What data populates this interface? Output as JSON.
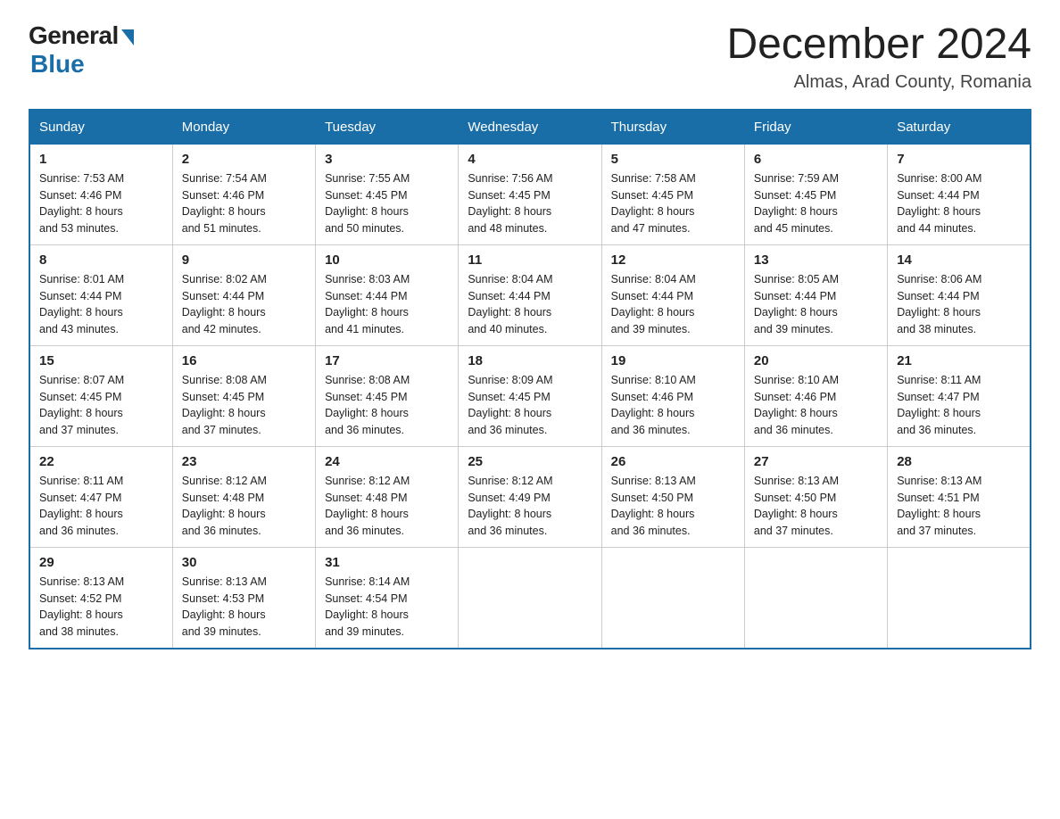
{
  "logo": {
    "general": "General",
    "blue": "Blue"
  },
  "title": "December 2024",
  "location": "Almas, Arad County, Romania",
  "days_of_week": [
    "Sunday",
    "Monday",
    "Tuesday",
    "Wednesday",
    "Thursday",
    "Friday",
    "Saturday"
  ],
  "weeks": [
    [
      {
        "day": "1",
        "sunrise": "7:53 AM",
        "sunset": "4:46 PM",
        "daylight": "8 hours and 53 minutes."
      },
      {
        "day": "2",
        "sunrise": "7:54 AM",
        "sunset": "4:46 PM",
        "daylight": "8 hours and 51 minutes."
      },
      {
        "day": "3",
        "sunrise": "7:55 AM",
        "sunset": "4:45 PM",
        "daylight": "8 hours and 50 minutes."
      },
      {
        "day": "4",
        "sunrise": "7:56 AM",
        "sunset": "4:45 PM",
        "daylight": "8 hours and 48 minutes."
      },
      {
        "day": "5",
        "sunrise": "7:58 AM",
        "sunset": "4:45 PM",
        "daylight": "8 hours and 47 minutes."
      },
      {
        "day": "6",
        "sunrise": "7:59 AM",
        "sunset": "4:45 PM",
        "daylight": "8 hours and 45 minutes."
      },
      {
        "day": "7",
        "sunrise": "8:00 AM",
        "sunset": "4:44 PM",
        "daylight": "8 hours and 44 minutes."
      }
    ],
    [
      {
        "day": "8",
        "sunrise": "8:01 AM",
        "sunset": "4:44 PM",
        "daylight": "8 hours and 43 minutes."
      },
      {
        "day": "9",
        "sunrise": "8:02 AM",
        "sunset": "4:44 PM",
        "daylight": "8 hours and 42 minutes."
      },
      {
        "day": "10",
        "sunrise": "8:03 AM",
        "sunset": "4:44 PM",
        "daylight": "8 hours and 41 minutes."
      },
      {
        "day": "11",
        "sunrise": "8:04 AM",
        "sunset": "4:44 PM",
        "daylight": "8 hours and 40 minutes."
      },
      {
        "day": "12",
        "sunrise": "8:04 AM",
        "sunset": "4:44 PM",
        "daylight": "8 hours and 39 minutes."
      },
      {
        "day": "13",
        "sunrise": "8:05 AM",
        "sunset": "4:44 PM",
        "daylight": "8 hours and 39 minutes."
      },
      {
        "day": "14",
        "sunrise": "8:06 AM",
        "sunset": "4:44 PM",
        "daylight": "8 hours and 38 minutes."
      }
    ],
    [
      {
        "day": "15",
        "sunrise": "8:07 AM",
        "sunset": "4:45 PM",
        "daylight": "8 hours and 37 minutes."
      },
      {
        "day": "16",
        "sunrise": "8:08 AM",
        "sunset": "4:45 PM",
        "daylight": "8 hours and 37 minutes."
      },
      {
        "day": "17",
        "sunrise": "8:08 AM",
        "sunset": "4:45 PM",
        "daylight": "8 hours and 36 minutes."
      },
      {
        "day": "18",
        "sunrise": "8:09 AM",
        "sunset": "4:45 PM",
        "daylight": "8 hours and 36 minutes."
      },
      {
        "day": "19",
        "sunrise": "8:10 AM",
        "sunset": "4:46 PM",
        "daylight": "8 hours and 36 minutes."
      },
      {
        "day": "20",
        "sunrise": "8:10 AM",
        "sunset": "4:46 PM",
        "daylight": "8 hours and 36 minutes."
      },
      {
        "day": "21",
        "sunrise": "8:11 AM",
        "sunset": "4:47 PM",
        "daylight": "8 hours and 36 minutes."
      }
    ],
    [
      {
        "day": "22",
        "sunrise": "8:11 AM",
        "sunset": "4:47 PM",
        "daylight": "8 hours and 36 minutes."
      },
      {
        "day": "23",
        "sunrise": "8:12 AM",
        "sunset": "4:48 PM",
        "daylight": "8 hours and 36 minutes."
      },
      {
        "day": "24",
        "sunrise": "8:12 AM",
        "sunset": "4:48 PM",
        "daylight": "8 hours and 36 minutes."
      },
      {
        "day": "25",
        "sunrise": "8:12 AM",
        "sunset": "4:49 PM",
        "daylight": "8 hours and 36 minutes."
      },
      {
        "day": "26",
        "sunrise": "8:13 AM",
        "sunset": "4:50 PM",
        "daylight": "8 hours and 36 minutes."
      },
      {
        "day": "27",
        "sunrise": "8:13 AM",
        "sunset": "4:50 PM",
        "daylight": "8 hours and 37 minutes."
      },
      {
        "day": "28",
        "sunrise": "8:13 AM",
        "sunset": "4:51 PM",
        "daylight": "8 hours and 37 minutes."
      }
    ],
    [
      {
        "day": "29",
        "sunrise": "8:13 AM",
        "sunset": "4:52 PM",
        "daylight": "8 hours and 38 minutes."
      },
      {
        "day": "30",
        "sunrise": "8:13 AM",
        "sunset": "4:53 PM",
        "daylight": "8 hours and 39 minutes."
      },
      {
        "day": "31",
        "sunrise": "8:14 AM",
        "sunset": "4:54 PM",
        "daylight": "8 hours and 39 minutes."
      },
      null,
      null,
      null,
      null
    ]
  ],
  "labels": {
    "sunrise": "Sunrise:",
    "sunset": "Sunset:",
    "daylight": "Daylight:"
  }
}
